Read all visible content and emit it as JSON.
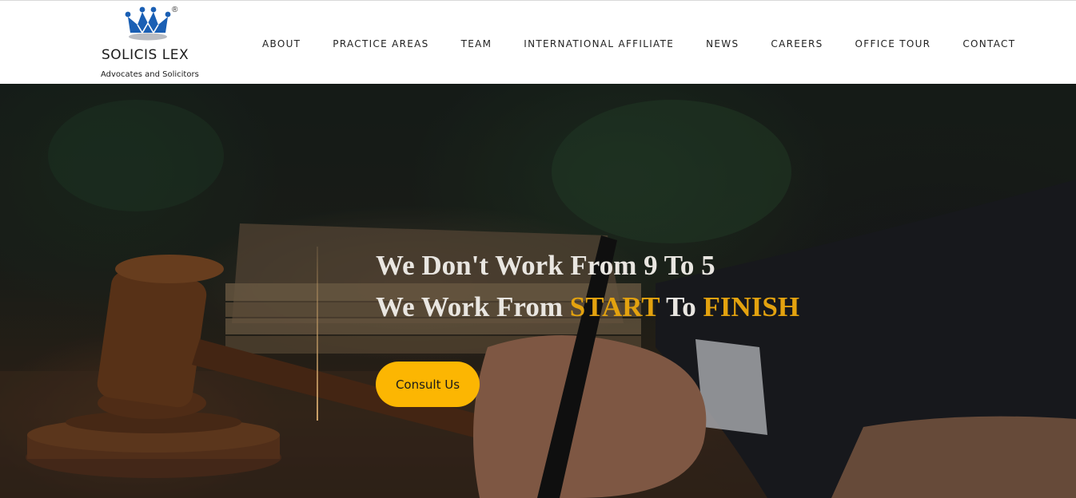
{
  "brand": {
    "registered_mark": "®",
    "name": "SOLICIS LEX",
    "tagline": "Advocates and Solicitors",
    "crown_color": "#1a5fb4"
  },
  "nav": {
    "items": [
      {
        "label": "ABOUT"
      },
      {
        "label": "PRACTICE AREAS"
      },
      {
        "label": "TEAM"
      },
      {
        "label": "INTERNATIONAL AFFILIATE"
      },
      {
        "label": "NEWS"
      },
      {
        "label": "CAREERS"
      },
      {
        "label": "OFFICE TOUR"
      },
      {
        "label": "CONTACT"
      }
    ]
  },
  "hero": {
    "line1": "We Don't Work From 9 To 5",
    "line2_prefix": "We Work From ",
    "line2_highlight1": "START",
    "line2_middle": " To ",
    "line2_highlight2": "FINISH",
    "cta_label": "Consult Us",
    "accent_color": "#e3a20f",
    "cta_color": "#fcb602"
  }
}
